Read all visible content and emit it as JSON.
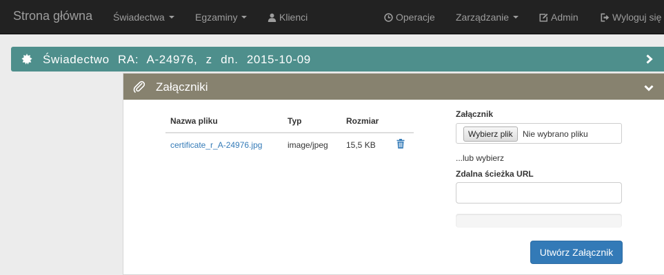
{
  "navbar": {
    "brand": "Strona główna",
    "items": [
      {
        "label": "Świadectwa",
        "dropdown": true
      },
      {
        "label": "Egzaminy",
        "dropdown": true
      },
      {
        "label": "Klienci",
        "icon": "user-icon"
      },
      {
        "label": "Operacje",
        "icon": "clock-icon"
      },
      {
        "label": "Zarządzanie",
        "dropdown": true
      },
      {
        "label": "Admin",
        "icon": "edit-icon"
      },
      {
        "label": "Wyloguj się",
        "icon": "logout-icon"
      }
    ]
  },
  "certificate": {
    "title": "Świadectwo RA: A-24976, z dn. 2015-10-09",
    "icon": "certificate-icon",
    "color": "#4e8f8c"
  },
  "attachments": {
    "title": "Załączniki",
    "icon": "paperclip-icon",
    "color": "#87826f",
    "table": {
      "headers": [
        "Nazwa pliku",
        "Typ",
        "Rozmiar"
      ],
      "rows": [
        {
          "name": "certificate_r_A-24976.jpg",
          "type": "image/jpeg",
          "size": "15,5 KB"
        }
      ]
    },
    "form": {
      "file_label": "Załącznik",
      "file_button": "Wybierz plik",
      "file_status": "Nie wybrano pliku",
      "or_text": "...lub wybierz",
      "url_label": "Zdalna ścieżka URL",
      "url_value": "",
      "progress": 0,
      "submit_label": "Utwórz Załącznik"
    }
  },
  "colors": {
    "navbar": "#222222",
    "link": "#337ab7",
    "primary_button": "#337ab7"
  }
}
